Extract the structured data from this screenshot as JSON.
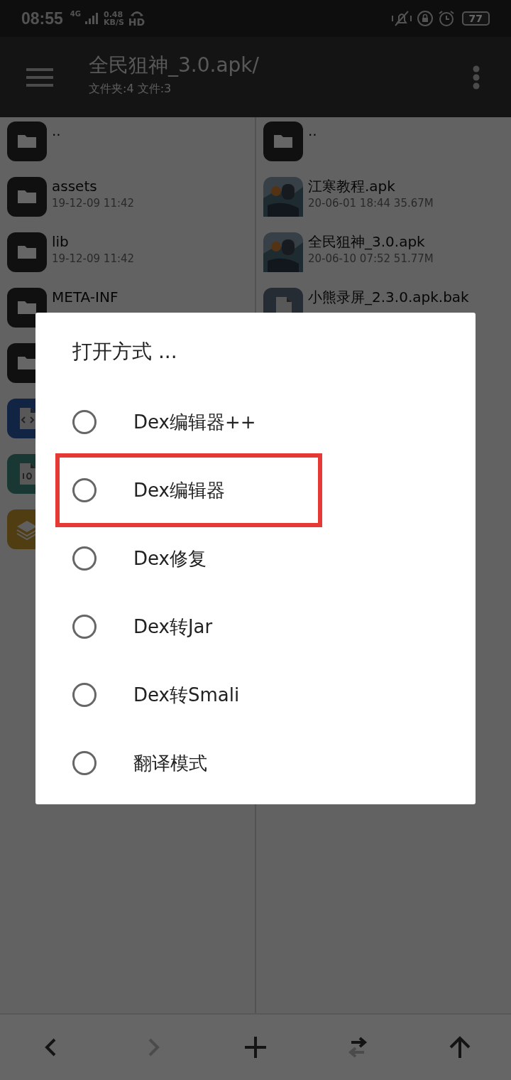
{
  "status_bar": {
    "time": "08:55",
    "network": "4G",
    "speed_value": "0.48",
    "speed_unit": "KB/S",
    "hd": "HD",
    "battery": "77"
  },
  "header": {
    "title": "全民狙神_3.0.apk/",
    "subtitle": "文件夹:4 文件:3"
  },
  "left_pane": {
    "items": [
      {
        "kind": "folder",
        "name": ".."
      },
      {
        "kind": "folder",
        "name": "assets",
        "meta": "19-12-09 11:42"
      },
      {
        "kind": "folder",
        "name": "lib",
        "meta": "19-12-09 11:42"
      },
      {
        "kind": "folder",
        "name": "META-INF"
      },
      {
        "kind": "folder"
      },
      {
        "kind": "xml"
      },
      {
        "kind": "binary"
      },
      {
        "kind": "layers"
      }
    ]
  },
  "right_pane": {
    "items": [
      {
        "kind": "folder",
        "name": ".."
      },
      {
        "kind": "picture",
        "name": "江寒教程.apk",
        "meta": "20-06-01 18:44  35.67M"
      },
      {
        "kind": "picture",
        "name": "全民狙神_3.0.apk",
        "meta": "20-06-10 07:52  51.77M"
      },
      {
        "kind": "file",
        "name": "小熊录屏_2.3.0.apk.bak"
      }
    ]
  },
  "dialog": {
    "title": "打开方式 ...",
    "options": [
      {
        "label": "Dex编辑器++",
        "selected": false,
        "highlighted": false
      },
      {
        "label": "Dex编辑器",
        "selected": false,
        "highlighted": true
      },
      {
        "label": "Dex修复",
        "selected": false,
        "highlighted": false
      },
      {
        "label": "Dex转Jar",
        "selected": false,
        "highlighted": false
      },
      {
        "label": "Dex转Smali",
        "selected": false,
        "highlighted": false
      },
      {
        "label": "翻译模式",
        "selected": false,
        "highlighted": false
      }
    ]
  },
  "bottom_bar": {
    "buttons": [
      {
        "kind": "back",
        "disabled": false
      },
      {
        "kind": "forward",
        "disabled": true
      },
      {
        "kind": "add",
        "disabled": false
      },
      {
        "kind": "swap",
        "disabled": false
      },
      {
        "kind": "up",
        "disabled": false
      }
    ]
  }
}
